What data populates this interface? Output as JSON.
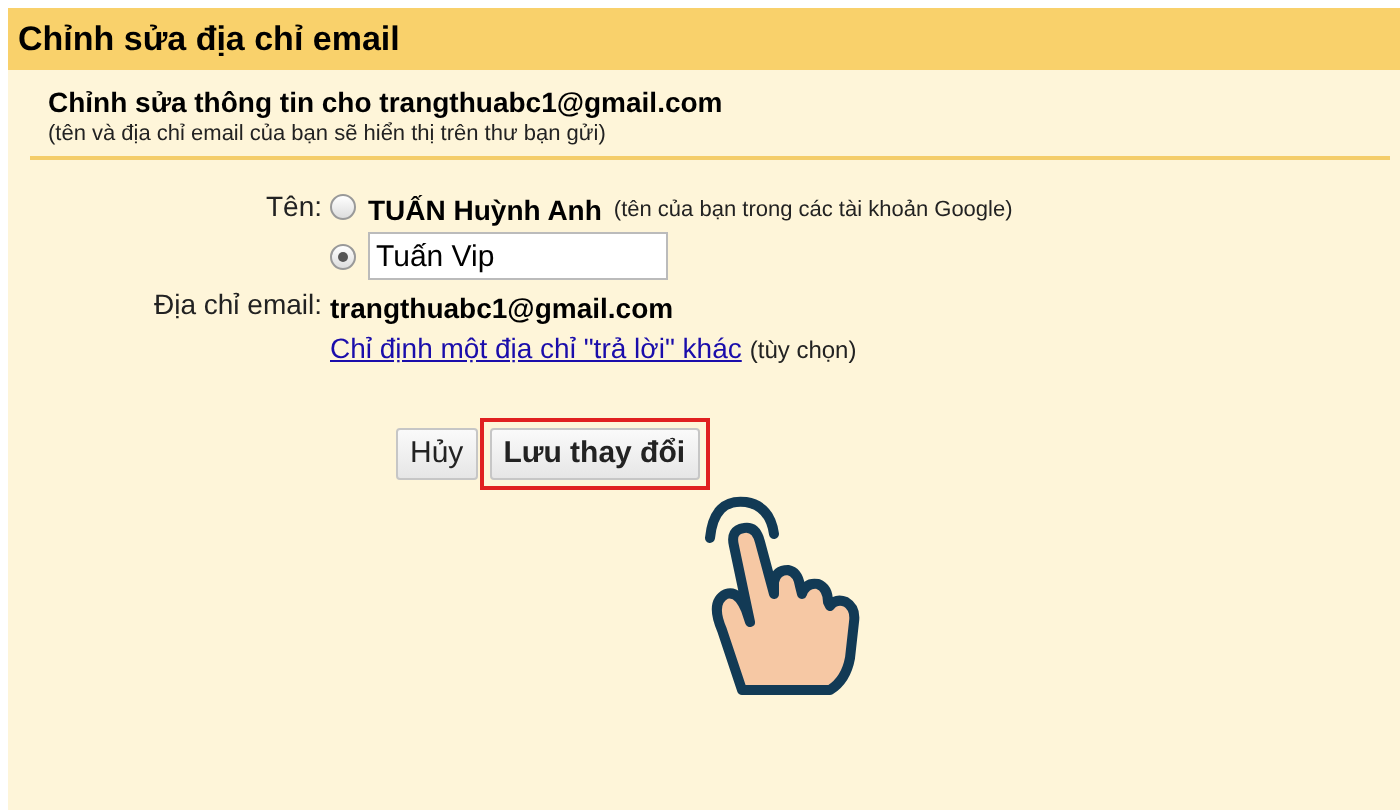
{
  "dialog": {
    "title": "Chỉnh sửa địa chỉ email"
  },
  "section": {
    "heading": "Chỉnh sửa thông tin cho trangthuabc1@gmail.com",
    "subtitle": "(tên và địa chỉ email của bạn sẽ hiển thị trên thư bạn gửi)"
  },
  "name_field": {
    "label": "Tên:",
    "options": [
      {
        "kind": "text",
        "name": "TUẤN Huỳnh Anh",
        "note": "(tên của bạn trong các tài khoản Google)",
        "selected": false
      },
      {
        "kind": "input",
        "value": "Tuấn Vip",
        "selected": true
      }
    ]
  },
  "email_field": {
    "label": "Địa chỉ email:",
    "value": "trangthuabc1@gmail.com",
    "link": "Chỉ định một địa chỉ \"trả lời\" khác",
    "link_note": "(tùy chọn)"
  },
  "buttons": [
    {
      "label": "Hủy",
      "primary": false,
      "highlighted": false
    },
    {
      "label": "Lưu thay đổi",
      "primary": true,
      "highlighted": true
    }
  ]
}
